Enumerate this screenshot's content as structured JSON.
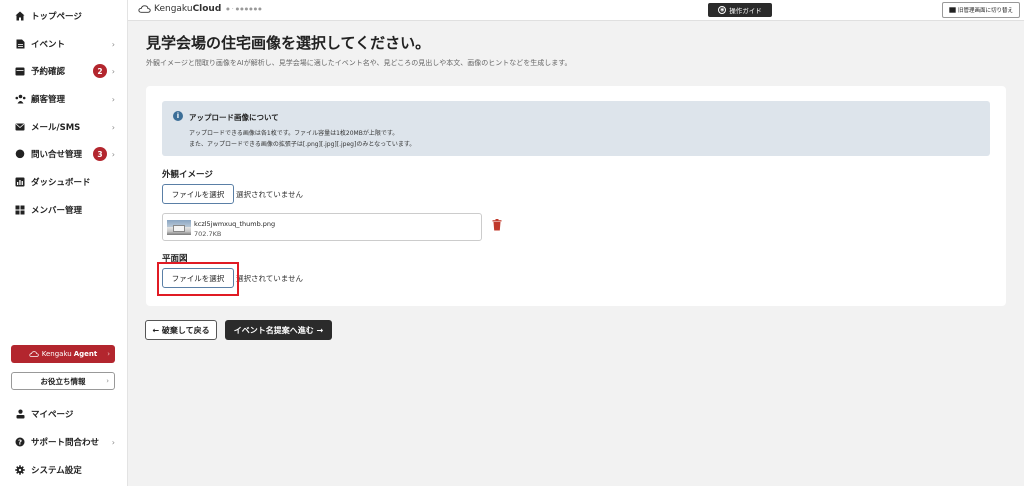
{
  "sidebar": {
    "items": [
      {
        "label": "トップページ",
        "icon": "home-icon"
      },
      {
        "label": "イベント",
        "icon": "document-icon"
      },
      {
        "label": "予約確認",
        "icon": "calendar-icon",
        "badge": "2"
      },
      {
        "label": "顧客管理",
        "icon": "users-icon"
      },
      {
        "label": "メール/SMS",
        "icon": "mail-icon"
      },
      {
        "label": "問い合せ管理",
        "icon": "chat-icon",
        "badge": "3"
      },
      {
        "label": "ダッシュボード",
        "icon": "chart-icon"
      },
      {
        "label": "メンバー管理",
        "icon": "grid-icon"
      }
    ],
    "agent_brand": "Kengaku",
    "agent_bold": "Agent",
    "useful_label": "お役立ち情報",
    "bottom_items": [
      {
        "label": "マイページ",
        "icon": "person-icon"
      },
      {
        "label": "サポート問合わせ",
        "icon": "help-icon"
      },
      {
        "label": "システム設定",
        "icon": "gear-icon"
      }
    ]
  },
  "topbar": {
    "logo_text": "Kengaku",
    "logo_bold": "Cloud",
    "logo_dots": "●・●●●●●●",
    "guide_label": "操作ガイド",
    "switch_label": "旧管理画面に切り替え"
  },
  "main": {
    "title": "見学会場の住宅画像を選択してください。",
    "description": "外観イメージと間取り画像をAIが解析し、見学会場に適したイベント名や、見どころの見出しや本文、画像のヒントなどを生成します。",
    "info": {
      "title": "アップロード画像について",
      "line1": "アップロードできる画像は各1枚です。ファイル容量は1枚20MBが上限です。",
      "line2": "また、アップロードできる画像の拡張子は[.png][.jpg][.jpeg]のみとなっています。"
    },
    "exterior": {
      "label": "外観イメージ",
      "button": "ファイルを選択",
      "status": "選択されていません",
      "file_name": "kczl5jwmxuq_thumb.png",
      "file_size": "702.7KB"
    },
    "floorplan": {
      "label": "平面図",
      "button": "ファイルを選択",
      "status": "選択されていません"
    },
    "back_label": "← 破棄して戻る",
    "next_label": "イベント名提案へ進む →"
  },
  "colors": {
    "accent_red": "#b3262e",
    "dark_button": "#2b2b2b",
    "info_bg": "#dde4eb",
    "highlight": "#e01b24"
  }
}
